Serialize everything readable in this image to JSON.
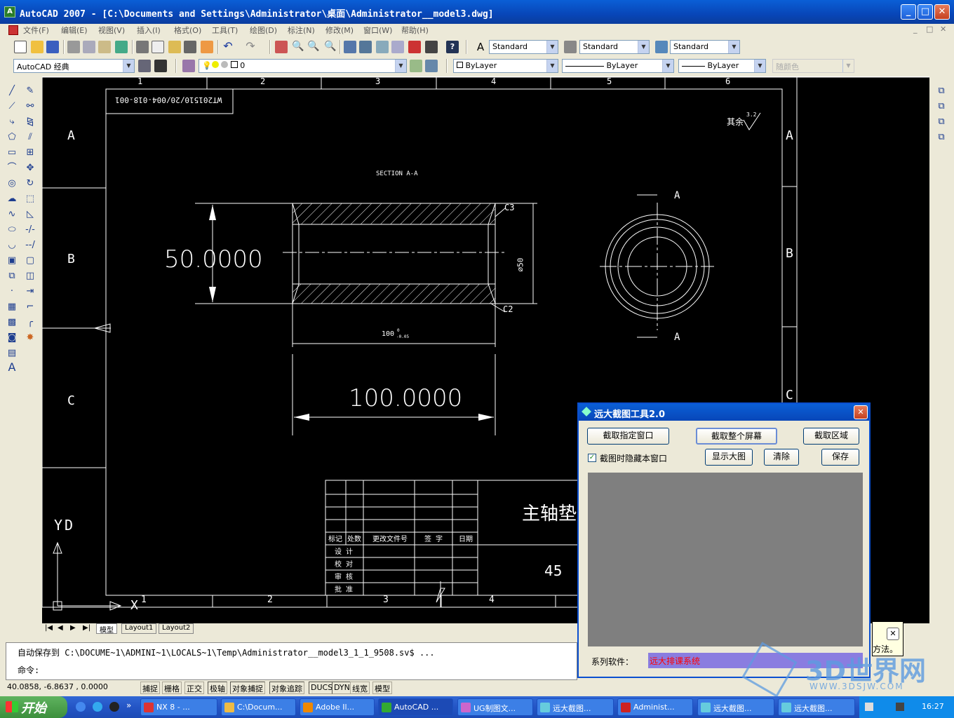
{
  "window": {
    "title": "AutoCAD 2007 - [C:\\Documents and Settings\\Administrator\\桌面\\Administrator__model3.dwg]",
    "minimize": "_",
    "maximize": "□",
    "close": "✕"
  },
  "menu": [
    "文件(F)",
    "编辑(E)",
    "视图(V)",
    "插入(I)",
    "格式(O)",
    "工具(T)",
    "绘图(D)",
    "标注(N)",
    "修改(M)",
    "窗口(W)",
    "帮助(H)"
  ],
  "toolbar": {
    "text_style": "Standard",
    "dim_style": "Standard",
    "table_style": "Standard",
    "workspace": "AutoCAD 经典",
    "layer": "0",
    "color": "ByLayer",
    "linetype": "ByLayer",
    "lineweight": "ByLayer",
    "plot_style": "随颜色"
  },
  "drawing": {
    "border_cols": [
      "1",
      "2",
      "3",
      "4",
      "5",
      "6"
    ],
    "border_rows": [
      "A",
      "B",
      "C"
    ],
    "right_rows": [
      "A",
      "B",
      "C"
    ],
    "bottom_cols": [
      "1",
      "2",
      "3",
      "4"
    ],
    "drawing_number": "WT201510/20/004-018-001",
    "roughness_note": "其余",
    "roughness_value": "3.2",
    "section_label": "SECTION A-A",
    "dim_height": "50.0000",
    "dim_length_big": "100.0000",
    "dim_length_small": "100",
    "dim_length_tol_upper": "0",
    "dim_length_tol_lower": "-0.05",
    "dim_diameter": "∅50",
    "chamfer_top": "C3",
    "chamfer_bottom": "C2",
    "section_mark": "A",
    "part_name": "主轴垫",
    "material": "45",
    "table_headers": [
      "标记",
      "处数",
      "更改文件号",
      "签 字",
      "日期"
    ],
    "table_rows": [
      "设 计",
      "校 对",
      "审 核",
      "批 准"
    ],
    "ucs_y": "Y",
    "ucs_x": "X",
    "ucs_d": "D"
  },
  "tabs": [
    "模型",
    "Layout1",
    "Layout2"
  ],
  "command": {
    "line1": "自动保存到 C:\\DOCUME~1\\ADMINI~1\\LOCALS~1\\Temp\\Administrator__model3_1_1_9508.sv$ ...",
    "prompt": "命令:"
  },
  "status": {
    "coords": "40.0858,  -6.8637 , 0.0000",
    "toggles": [
      "捕捉",
      "栅格",
      "正交",
      "极轴",
      "对象捕捉",
      "对象追踪",
      "DUCS",
      "DYN",
      "线宽",
      "模型"
    ]
  },
  "dialog": {
    "title": "远大截图工具2.0",
    "btn_window": "截取指定窗口",
    "btn_fullscreen": "截取整个屏幕",
    "btn_region": "截取区域",
    "hide_checkbox": "截图时隐藏本窗口",
    "btn_show": "显示大图",
    "btn_clear": "清除",
    "btn_save": "保存",
    "series_label": "系列软件：",
    "series_value": "远大排课系统"
  },
  "popup": {
    "text": "方法。"
  },
  "watermark": {
    "title": "3D世界网",
    "url": "WWW.3DSJW.COM"
  },
  "taskbar": {
    "start": "开始",
    "tasks": [
      "NX 8 - ...",
      "C:\\Docum...",
      "Adobe Il...",
      "AutoCAD ...",
      "UG制图文...",
      "远大截图...",
      "Administ...",
      "远大截图...",
      "远大截图..."
    ],
    "clock": "16:27"
  },
  "colors": {
    "accent": "#0a4fd0",
    "canvas": "#000000",
    "series_bg": "#8a7de0",
    "series_fg": "#ff0000"
  }
}
